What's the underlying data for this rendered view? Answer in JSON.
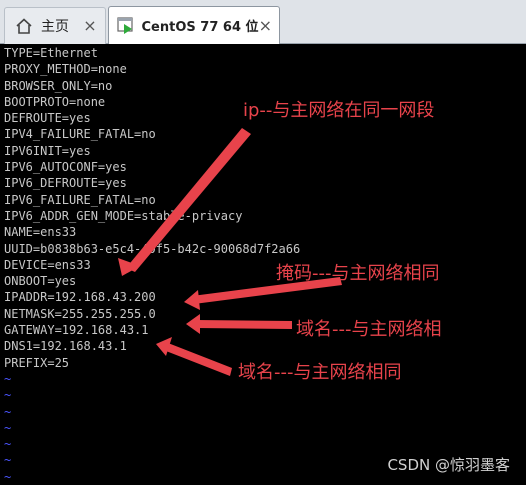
{
  "tabs": [
    {
      "label": "主页",
      "icon": "home-icon",
      "active": false
    },
    {
      "label": "CentOS 77 64 位",
      "icon": "vm-play-icon",
      "active": true
    }
  ],
  "terminal": {
    "lines": [
      "TYPE=Ethernet",
      "PROXY_METHOD=none",
      "BROWSER_ONLY=no",
      "BOOTPROTO=none",
      "DEFROUTE=yes",
      "IPV4_FAILURE_FATAL=no",
      "IPV6INIT=yes",
      "IPV6_AUTOCONF=yes",
      "IPV6_DEFROUTE=yes",
      "IPV6_FAILURE_FATAL=no",
      "IPV6_ADDR_GEN_MODE=stable-privacy",
      "NAME=ens33",
      "UUID=b0838b63-e5c4-40f5-b42c-90068d7f2a66",
      "DEVICE=ens33",
      "ONBOOT=yes",
      "IPADDR=192.168.43.200",
      "NETMASK=255.255.255.0",
      "GATEWAY=192.168.43.1",
      "DNS1=192.168.43.1",
      "PREFIX=25"
    ],
    "tildes": [
      "~",
      "~",
      "~",
      "~",
      "~",
      "~",
      "~",
      "~"
    ]
  },
  "annotations": {
    "ip": "ip--与主网络在同一网段",
    "mask": "掩码---与主网络相同",
    "gateway": "域名---与主网络相",
    "dns": "域名---与主网络相同"
  },
  "watermark": "CSDN @惊羽墨客",
  "colors": {
    "annotation": "#e8434b",
    "terminal_text": "#c8c8c8",
    "tilde": "#4a55ff",
    "background": "#000000"
  }
}
